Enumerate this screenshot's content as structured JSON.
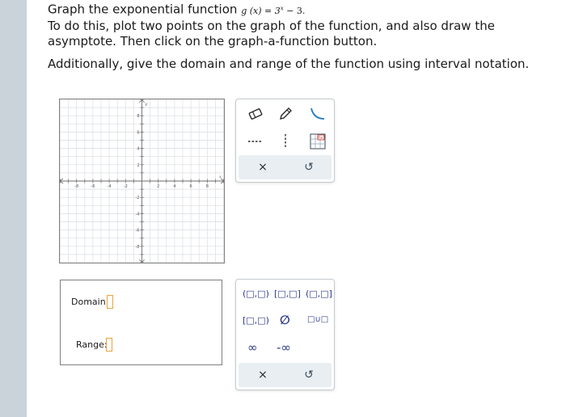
{
  "instructions": {
    "line1_prefix": "Graph the exponential function",
    "function_lhs": "g (x) = 3",
    "function_exp": "x",
    "function_rhs": " − 3.",
    "line2": "To do this, plot two points on the graph of the function, and also draw the asymptote. Then click on the graph-a-function button.",
    "line3": "Additionally, give the domain and range of the function using interval notation."
  },
  "graph": {
    "x_tick_labels": [
      "-8",
      "-6",
      "-4",
      "-2",
      "2",
      "4",
      "6",
      "8"
    ],
    "y_tick_labels": [
      "8",
      "6",
      "4",
      "2",
      "-2",
      "-4",
      "-6",
      "-8"
    ],
    "x_axis_label": "x",
    "y_axis_label": "y"
  },
  "graph_tools": {
    "icons": [
      "eraser-icon",
      "pencil-icon",
      "curve-icon",
      "dashed-line-icon",
      "vertical-dashed-line-icon",
      "function-grid-icon"
    ],
    "clear_label": "×",
    "undo_label": "↺"
  },
  "answer": {
    "domain_label": "Domain:",
    "range_label": "Range:",
    "domain_value": "",
    "range_value": ""
  },
  "interval_tools": {
    "row1": [
      "(□,□)",
      "[□,□]",
      "(□,□]"
    ],
    "row2": [
      "[□,□)",
      "∅",
      "□∪□"
    ],
    "row3": [
      "∞",
      "-∞"
    ],
    "clear_label": "×",
    "undo_label": "↺"
  },
  "colors": {
    "accent": "#2d3a8c",
    "icon_blue": "#1f7ac2",
    "input_border": "#e9a33c",
    "sidebar": "#c9d3d9",
    "footer_bg": "#e8eef2"
  }
}
